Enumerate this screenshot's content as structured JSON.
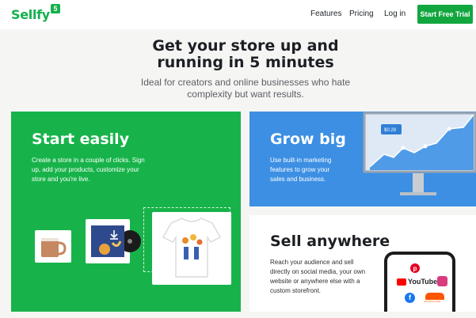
{
  "nav": {
    "logo": "Sellfy",
    "logo_badge": "5",
    "links": [
      "Features",
      "Pricing",
      "Log in"
    ],
    "cta": "Start Free Trial"
  },
  "hero": {
    "title_line1": "Get your store up and",
    "title_line2": "running in 5 minutes",
    "subtitle_line1": "Ideal for creators and online businesses who hate",
    "subtitle_line2": "complexity but want results."
  },
  "cards": {
    "start": {
      "title": "Start easily",
      "body": "Create a store in a couple of clicks. Sign up, add your products, customize your store and you're live."
    },
    "grow": {
      "title": "Grow big",
      "body": "Use built-in marketing features to grow your sales and business.",
      "price_tag": "$0.29"
    },
    "sell": {
      "title": "Sell anywhere",
      "body": "Reach your audience and sell directly on social media, your own website or anywhere else with a custom storefront.",
      "youtube_label": "YouTube",
      "soundcloud_label": "SOUNDCLOUD"
    }
  },
  "colors": {
    "brand_green": "#13b04b",
    "card_green": "#17b34a",
    "card_blue": "#3c8fe3",
    "page_bg": "#f5f5f4"
  },
  "icons": [
    "pinterest-icon",
    "youtube-icon",
    "instagram-icon",
    "facebook-icon",
    "soundcloud-icon",
    "download-icon"
  ]
}
